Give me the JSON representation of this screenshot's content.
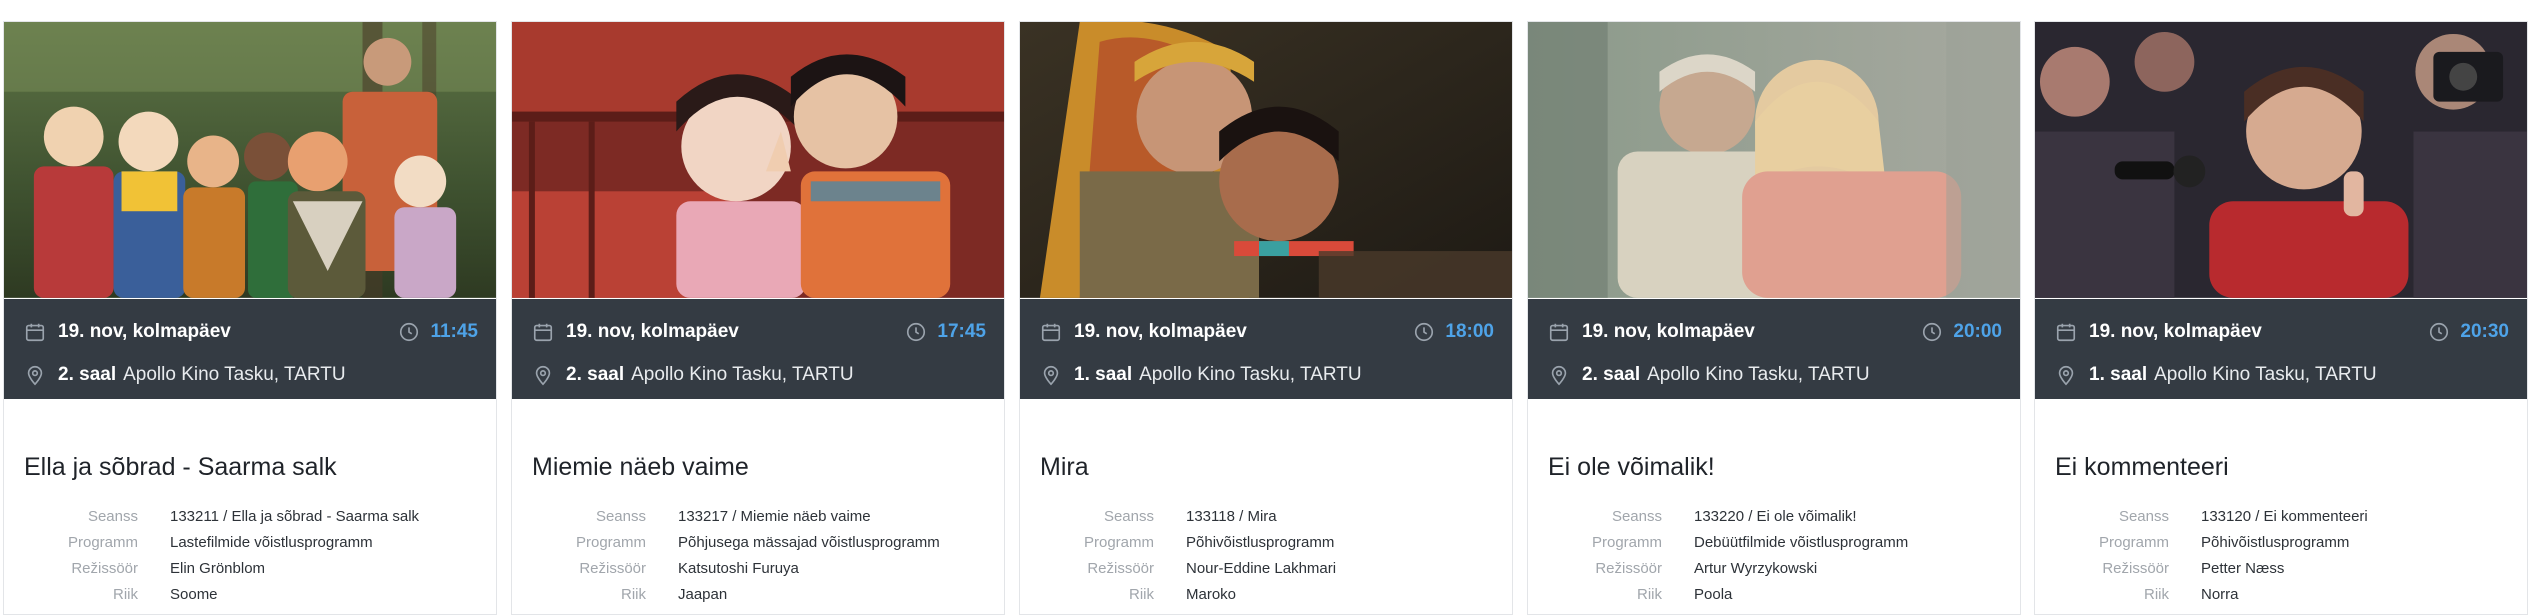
{
  "labels": {
    "session": "Seanss",
    "program": "Programm",
    "director": "Režissöör",
    "country": "Riik"
  },
  "icons": {
    "calendar": "calendar-icon",
    "clock": "clock-icon",
    "location": "location-pin-icon"
  },
  "colors": {
    "info_bar": "#343b43",
    "time_accent": "#4ea3e8"
  },
  "screenings": [
    {
      "image_alt": "Ella ja sõbrad - Saarma salk still",
      "date": "19. nov, kolmapäev",
      "time": "11:45",
      "hall": "2. saal",
      "venue": "Apollo Kino Tasku, TARTU",
      "title": "Ella ja sõbrad - Saarma salk",
      "session": "133211 / Ella ja sõbrad - Saarma salk",
      "program": "Lastefilmide võistlusprogramm",
      "director": "Elin Grönblom",
      "country": "Soome"
    },
    {
      "image_alt": "Miemie näeb vaime still",
      "date": "19. nov, kolmapäev",
      "time": "17:45",
      "hall": "2. saal",
      "venue": "Apollo Kino Tasku, TARTU",
      "title": "Miemie näeb vaime",
      "session": "133217 / Miemie näeb vaime",
      "program": "Põhjusega mässajad võistlusprogramm",
      "director": "Katsutoshi Furuya",
      "country": "Jaapan"
    },
    {
      "image_alt": "Mira still",
      "date": "19. nov, kolmapäev",
      "time": "18:00",
      "hall": "1. saal",
      "venue": "Apollo Kino Tasku, TARTU",
      "title": "Mira",
      "session": "133118 / Mira",
      "program": "Põhivõistlusprogramm",
      "director": "Nour-Eddine Lakhmari",
      "country": "Maroko"
    },
    {
      "image_alt": "Ei ole võimalik! still",
      "date": "19. nov, kolmapäev",
      "time": "20:00",
      "hall": "2. saal",
      "venue": "Apollo Kino Tasku, TARTU",
      "title": "Ei ole võimalik!",
      "session": "133220 / Ei ole võimalik!",
      "program": "Debüütfilmide võistlusprogramm",
      "director": "Artur Wyrzykowski",
      "country": "Poola"
    },
    {
      "image_alt": "Ei kommenteeri still",
      "date": "19. nov, kolmapäev",
      "time": "20:30",
      "hall": "1. saal",
      "venue": "Apollo Kino Tasku, TARTU",
      "title": "Ei kommenteeri",
      "session": "133120 / Ei kommenteeri",
      "program": "Põhivõistlusprogramm",
      "director": "Petter Næss",
      "country": "Norra"
    }
  ]
}
